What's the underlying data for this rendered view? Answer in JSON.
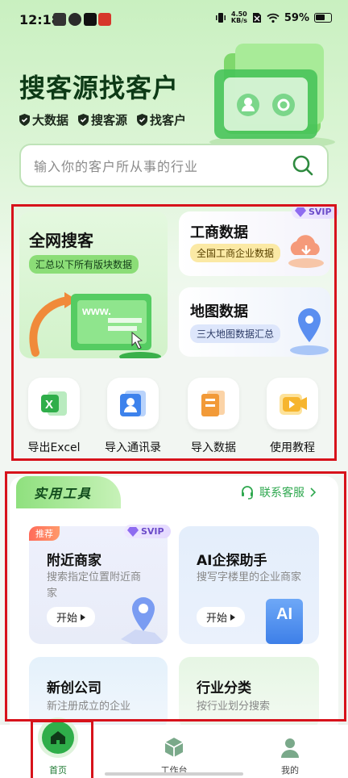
{
  "status_bar": {
    "time": "12:18",
    "net_speed_value": "4.50",
    "net_speed_unit": "KB/s",
    "battery": "59%"
  },
  "hero": {
    "title": "搜客源找客户",
    "tags": [
      "大数据",
      "搜客源",
      "找客户"
    ]
  },
  "search": {
    "placeholder": "输入你的客户所从事的行业"
  },
  "features": {
    "whole_net": {
      "title": "全网搜客",
      "subtitle": "汇总以下所有版块数据",
      "banner_text": "www."
    },
    "business": {
      "title": "工商数据",
      "subtitle": "全国工商企业数据",
      "badge": "SVIP"
    },
    "map": {
      "title": "地图数据",
      "subtitle": "三大地图数据汇总"
    }
  },
  "quick_tools": [
    {
      "label": "导出Excel",
      "icon": "excel-icon"
    },
    {
      "label": "导入通讯录",
      "icon": "contacts-icon"
    },
    {
      "label": "导入数据",
      "icon": "import-data-icon"
    },
    {
      "label": "使用教程",
      "icon": "video-tutorial-icon"
    }
  ],
  "practical": {
    "tab_label": "实用工具",
    "contact_label": "联系客服",
    "cards": [
      {
        "title": "附近商家",
        "desc": "搜索指定位置附近商家",
        "start": "开始",
        "badge": "推荐",
        "vip": "SVIP"
      },
      {
        "title": "AI企探助手",
        "desc": "搜写字楼里的企业商家",
        "start": "开始",
        "icon_text": "AI"
      },
      {
        "title": "新创公司",
        "desc": "新注册成立的企业"
      },
      {
        "title": "行业分类",
        "desc": "按行业划分搜索"
      }
    ]
  },
  "bottom_nav": [
    {
      "label": "首页"
    },
    {
      "label": "工作台"
    },
    {
      "label": "我的"
    }
  ],
  "colors": {
    "brand_green": "#2fae4a",
    "highlight_red": "#d7121b",
    "vip_purple": "#6b4bc9"
  }
}
